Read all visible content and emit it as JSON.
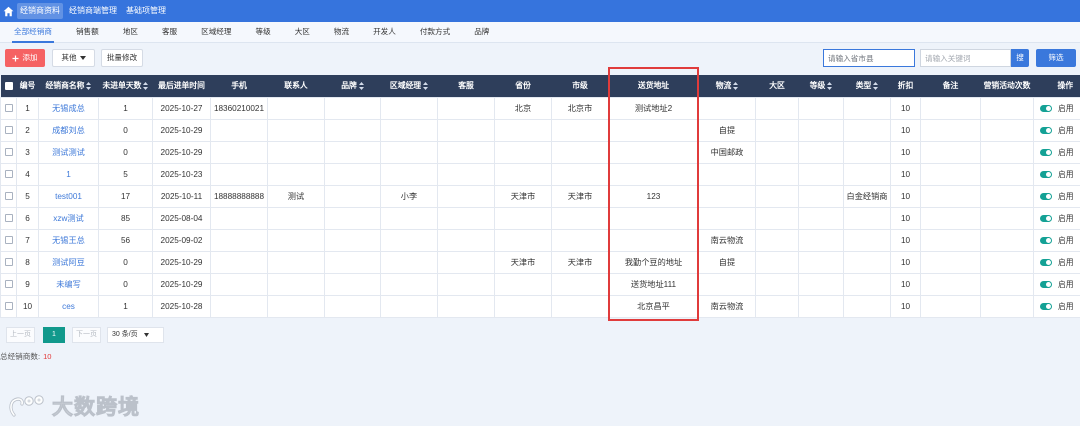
{
  "topnav": {
    "items": [
      {
        "label": "经销商资料",
        "active": true
      },
      {
        "label": "经销商端管理",
        "active": false
      },
      {
        "label": "基础项管理",
        "active": false
      }
    ]
  },
  "subtabs": [
    {
      "label": "全部经销商",
      "active": true
    },
    {
      "label": "销售额"
    },
    {
      "label": "地区"
    },
    {
      "label": "客服"
    },
    {
      "label": "区域经理"
    },
    {
      "label": "等级"
    },
    {
      "label": "大区"
    },
    {
      "label": "物流"
    },
    {
      "label": "开发人"
    },
    {
      "label": "付款方式"
    },
    {
      "label": "品牌"
    }
  ],
  "toolbar": {
    "add_label": "添加",
    "other_label": "其他",
    "batch_label": "批量修改",
    "region_placeholder": "请输入省市县",
    "keyword_placeholder": "请输入关键词",
    "search_label": "搜",
    "filter_label": "筛选"
  },
  "table": {
    "columns": [
      {
        "label": "编号"
      },
      {
        "label": "经销商名称",
        "sortable": true
      },
      {
        "label": "未进单天数",
        "sortable": true
      },
      {
        "label": "最后进单时间"
      },
      {
        "label": "手机"
      },
      {
        "label": "联系人"
      },
      {
        "label": "品牌",
        "sortable": true
      },
      {
        "label": "区域经理",
        "sortable": true
      },
      {
        "label": "客服"
      },
      {
        "label": "省份"
      },
      {
        "label": "市级"
      },
      {
        "label": "送货地址"
      },
      {
        "label": "物流",
        "sortable": true
      },
      {
        "label": "大区"
      },
      {
        "label": "等级",
        "sortable": true
      },
      {
        "label": "类型",
        "sortable": true
      },
      {
        "label": "折扣"
      },
      {
        "label": "备注"
      },
      {
        "label": "营销活动次数"
      },
      {
        "label": "操作"
      }
    ],
    "rows": [
      {
        "id": "1",
        "name": "无锡成总",
        "days": "1",
        "last_order": "2025-10-27",
        "phone": "18360210021",
        "province": "北京",
        "city": "北京市",
        "address": "测试地址2",
        "discount": "10",
        "status": "启用",
        "enabled": true
      },
      {
        "id": "2",
        "name": "成都刘总",
        "days": "0",
        "last_order": "2025-10-29",
        "logistics": "自提",
        "discount": "10",
        "status": "启用",
        "enabled": true
      },
      {
        "id": "3",
        "name": "测试测试",
        "days": "0",
        "last_order": "2025-10-29",
        "logistics": "中国邮政",
        "discount": "10",
        "status": "启用",
        "enabled": true
      },
      {
        "id": "4",
        "name": "1",
        "days": "5",
        "last_order": "2025-10-23",
        "discount": "10",
        "status": "启用",
        "enabled": true
      },
      {
        "id": "5",
        "name": "test001",
        "days": "17",
        "last_order": "2025-10-11",
        "phone": "18888888888",
        "contact": "测试",
        "manager": "小李",
        "province": "天津市",
        "city": "天津市",
        "address": "123",
        "type": "白金经销商",
        "discount": "10",
        "status": "启用",
        "enabled": true
      },
      {
        "id": "6",
        "name": "xzw测试",
        "days": "85",
        "last_order": "2025-08-04",
        "discount": "10",
        "status": "启用",
        "enabled": true
      },
      {
        "id": "7",
        "name": "无锡王总",
        "days": "56",
        "last_order": "2025-09-02",
        "logistics": "南云物流",
        "discount": "10",
        "status": "启用",
        "enabled": true
      },
      {
        "id": "8",
        "name": "测试阿豆",
        "days": "0",
        "last_order": "2025-10-29",
        "province": "天津市",
        "city": "天津市",
        "address": "我勤个豆的地址",
        "logistics": "自提",
        "discount": "10",
        "status": "启用",
        "enabled": true
      },
      {
        "id": "9",
        "name": "未编写",
        "days": "0",
        "last_order": "2025-10-29",
        "address": "送货地址111",
        "discount": "10",
        "status": "启用",
        "enabled": true
      },
      {
        "id": "10",
        "name": "ces",
        "days": "1",
        "last_order": "2025-10-28",
        "address": "北京昌平",
        "logistics": "南云物流",
        "discount": "10",
        "status": "启用",
        "enabled": true
      }
    ]
  },
  "pagination": {
    "prev_label": "上一页",
    "current_page": "1",
    "next_label": "下一页",
    "page_size": "30 条/页"
  },
  "summary": {
    "label": "总经销商数:",
    "count": "10"
  },
  "watermark": {
    "brand": "大数跨境"
  },
  "icons": {
    "home": "home-icon",
    "add": "plus-icon",
    "dropdown": "chevron-down-icon",
    "sort": "sort-icon",
    "toggle": "toggle-switch",
    "logo": "brand-logo-icon"
  },
  "colors": {
    "navbar": "#3674dd",
    "table_header": "#2e3e5b",
    "link": "#3f7ad9",
    "add_button": "#f56263",
    "primary_button": "#3a78dc",
    "toggle_on": "#14a195",
    "pager_active": "#11998c",
    "highlight": "#e03b3b",
    "count": "#e33b3b"
  }
}
